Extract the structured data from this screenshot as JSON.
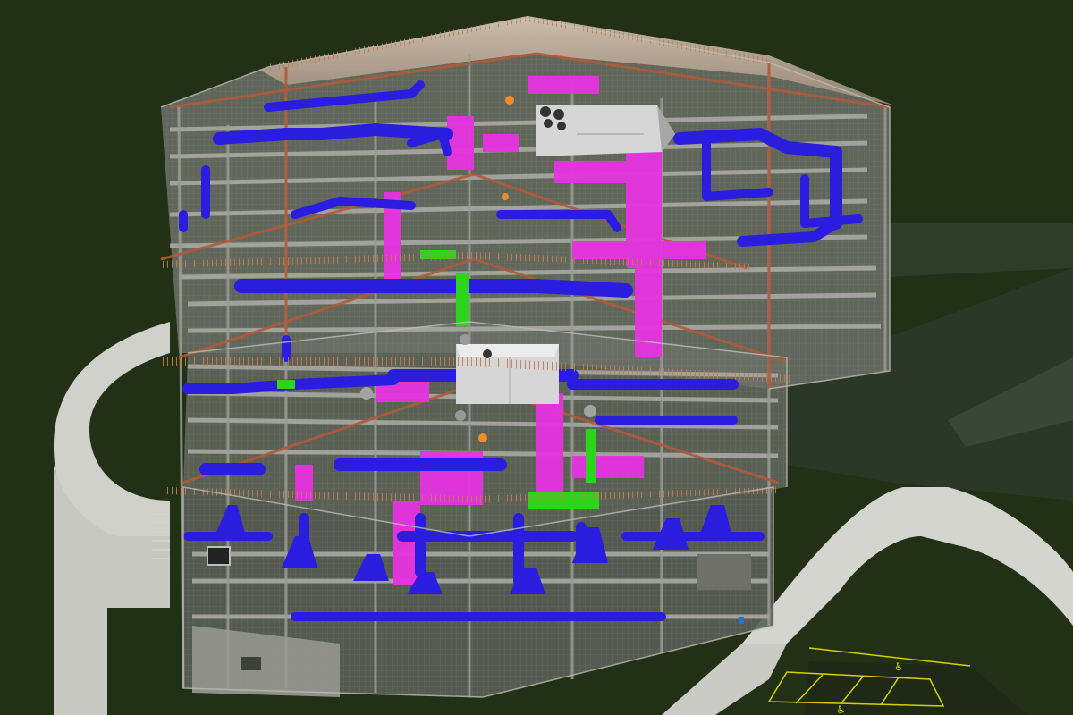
{
  "scene": {
    "kind": "BIM MEP coordination model — cutaway building view",
    "visible_text": []
  },
  "palette": {
    "background": "#223015",
    "terrain": "#2b3826",
    "road": "#c9cbc4",
    "steel": "#8d8d8d",
    "glazing": "#a9a9a9",
    "roof": "#b89d86",
    "truss": "#b05a3a",
    "supply_duct": "#2a1de0",
    "return_duct": "#e633e0",
    "piping": "#2bd51b",
    "equipment": "#d6d6d6",
    "parking_lines": "#d7d000"
  },
  "layers": [
    {
      "name": "supply-duct",
      "color": "#2a1de0"
    },
    {
      "name": "return-duct",
      "color": "#e633e0"
    },
    {
      "name": "piping",
      "color": "#2bd51b"
    },
    {
      "name": "structure",
      "color": "#8d8d8d"
    },
    {
      "name": "trusses",
      "color": "#b05a3a"
    },
    {
      "name": "equipment",
      "color": "#d6d6d6"
    }
  ],
  "parking": {
    "accessible_symbol": "♿"
  }
}
